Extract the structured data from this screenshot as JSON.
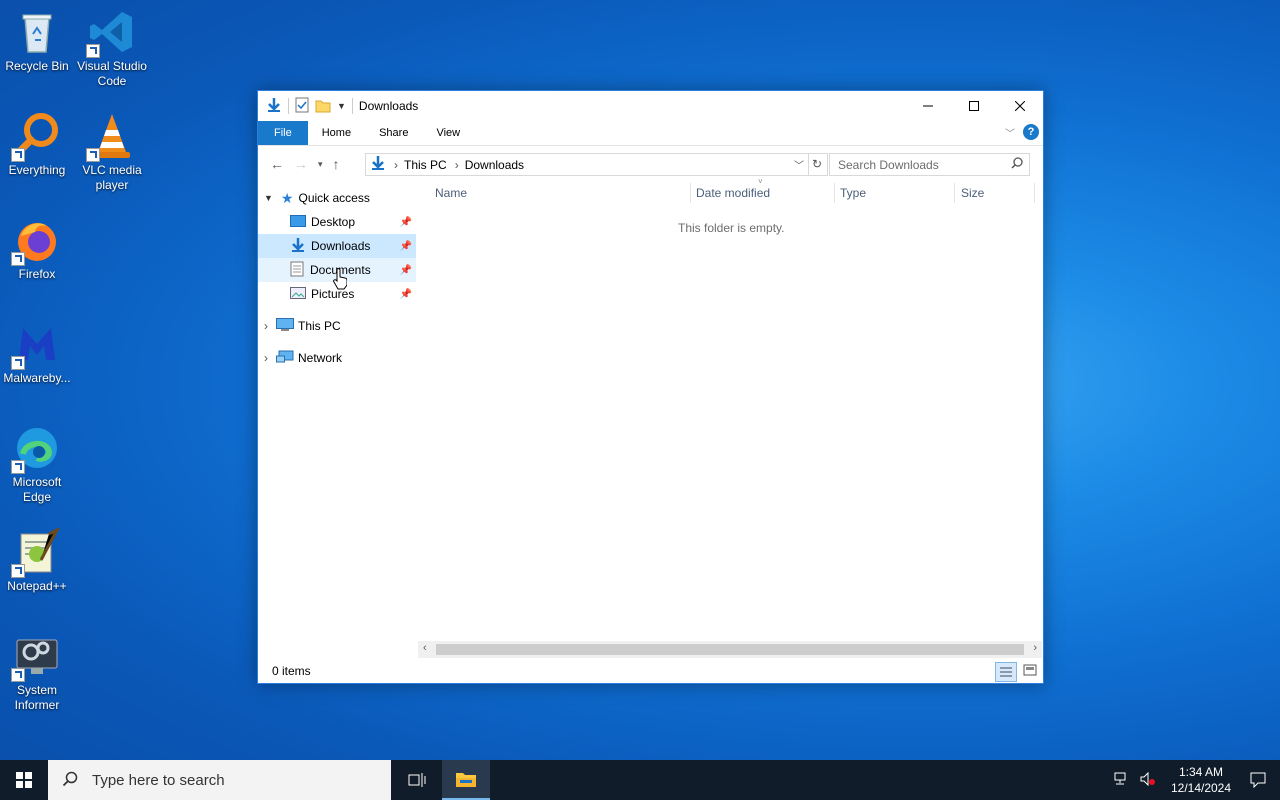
{
  "desktop": {
    "icons": [
      {
        "label": "Recycle Bin"
      },
      {
        "label": "Visual Studio Code"
      },
      {
        "label": "Everything"
      },
      {
        "label": "VLC media player"
      },
      {
        "label": "Firefox"
      },
      {
        "label": "Malwareby..."
      },
      {
        "label": "Microsoft Edge"
      },
      {
        "label": "Notepad++"
      },
      {
        "label": "System Informer"
      }
    ]
  },
  "window": {
    "title": "Downloads",
    "ribbon_tabs": [
      "File",
      "Home",
      "Share",
      "View"
    ],
    "address": {
      "crumbs": [
        "This PC",
        "Downloads"
      ]
    },
    "search_placeholder": "Search Downloads",
    "nav": {
      "quick_access": "Quick access",
      "items": [
        "Desktop",
        "Downloads",
        "Documents",
        "Pictures"
      ],
      "this_pc": "This PC",
      "network": "Network"
    },
    "columns": [
      "Name",
      "Date modified",
      "Type",
      "Size"
    ],
    "empty_message": "This folder is empty.",
    "status": "0 items"
  },
  "taskbar": {
    "search_placeholder": "Type here to search",
    "time": "1:34 AM",
    "date": "12/14/2024"
  },
  "colors": {
    "accent": "#1979ca",
    "selection": "#cce8ff",
    "taskbar": "#101c2a"
  }
}
